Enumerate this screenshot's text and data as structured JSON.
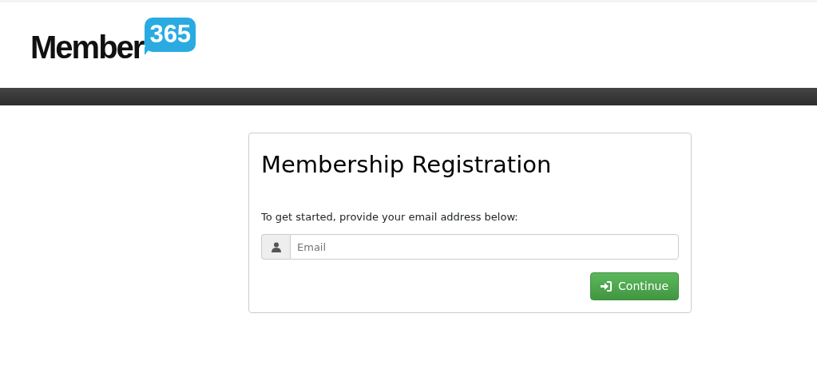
{
  "logo": {
    "word": "Member",
    "badge": "365"
  },
  "form": {
    "title": "Membership Registration",
    "prompt": "To get started, provide your email address below:",
    "email": {
      "placeholder": "Email"
    },
    "button": "Continue"
  }
}
